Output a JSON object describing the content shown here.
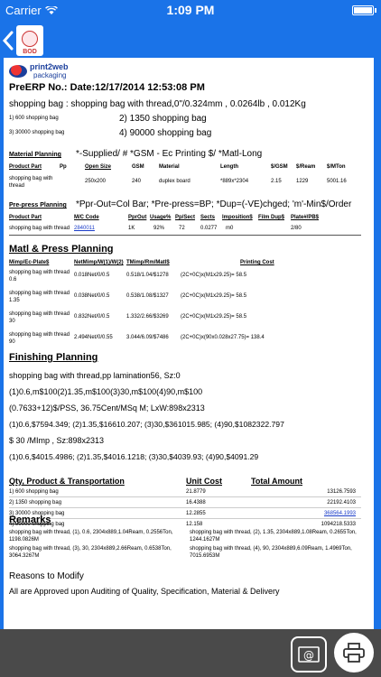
{
  "status": {
    "carrier": "Carrier",
    "time": "1:09 PM"
  },
  "nav": {
    "logo_label": "BOD"
  },
  "brand": {
    "name": "print2web",
    "sub": "packaging"
  },
  "doc": {
    "title": "PreERP No.: Date:12/17/2014 12:53:08 PM",
    "product_line": "shopping bag : shopping bag with thread,0\"/0.324mm , 0.0264lb , 0.012Kg",
    "qty_items": [
      "1) 600 shopping bag",
      "2) 1350 shopping bag",
      "3) 30000 shopping bag",
      "4) 90000 shopping bag"
    ]
  },
  "material_planning": {
    "title": "Material Planning",
    "legend": "*-Supplied/ # *GSM - Ec Printing $/ *Matl-Long",
    "headers": [
      "Product Part",
      "Pp",
      "Open Size",
      "GSM",
      "Material",
      "Length",
      "$/GSM",
      "$/Ream",
      "$/MTon"
    ],
    "row": [
      "shopping bag with thread",
      "",
      "250x200",
      "240",
      "duplex board",
      "*889x*2304",
      "2.15",
      "1229",
      "5001.16"
    ]
  },
  "prepress_planning": {
    "title": "Pre-press Planning",
    "legend": "*Ppr-Out=Col Bar; *Pre-press=BP; *Dup=(-VE)chged; 'm'-Min$/Order",
    "headers": [
      "Product Part",
      "M/C Code",
      "PprOut",
      "Usage%",
      "Pp/Sect",
      "Sects",
      "Imposition$",
      "Film Dup$",
      "Plate#/PB$"
    ],
    "row": [
      "shopping bag with thread",
      "2840011",
      "1K",
      "92%",
      "72",
      "0.0277",
      "m0",
      "",
      "2/80"
    ]
  },
  "matl_press": {
    "title": "Matl & Press Planning",
    "headers": [
      "Mimp/Ec-Plate$",
      "NetMimp/W(1)/W(2)",
      "TMimp/Rm/Matl$",
      "Printing Cost"
    ],
    "rows": [
      [
        "shopping bag with thread 0.6",
        "0.018Net/0/0.5",
        "0.518/1.04/$1278",
        "(2C+0C)x(M1x29.25)= 58.5"
      ],
      [
        "shopping bag with thread 1.35",
        "0.038Net/0/0.5",
        "0.538/1.08/$1327",
        "(2C+0C)x(M1x29.25)= 58.5"
      ],
      [
        "shopping bag with thread 30",
        "0.832Net/0/0.5",
        "1.332/2.66/$3269",
        "(2C+0C)x(M1x29.25)= 58.5"
      ],
      [
        "shopping bag with thread 90",
        "2.494Net/0/0.55",
        "3.044/6.09/$7486",
        "(2C+0C)x(90x0.028x27.75)= 138.4"
      ]
    ]
  },
  "finishing": {
    "title": "Finishing Planning",
    "lines": [
      "shopping bag with thread,pp lamination56, Sz:0",
      "(1)0.6,m$100(2)1.35,m$100(3)30,m$100(4)90,m$100",
      "(0.7633+12)$/PSS, 36.75Cent/MSq M; LxW:898x2313",
      "(1)0.6,$7594.349; (2)1.35,$16610.207; (3)30,$361015.985; (4)90,$1082322.797",
      "$ 30 /MImp , Sz:898x2313",
      "(1)0.6,$4015.4986; (2)1.35,$4016.1218; (3)30,$4039.93; (4)90,$4091.29"
    ]
  },
  "qty_transport": {
    "title": "Qty, Product & Transportation",
    "headers": [
      "Unit Cost",
      "Total Amount"
    ],
    "rows": [
      [
        "1) 600 shopping bag",
        "21.8779",
        "13126.7593"
      ],
      [
        "2) 1350 shopping bag",
        "16.4388",
        "22192.4103"
      ],
      [
        "3) 30000 shopping bag",
        "12.2855",
        "368564.1993"
      ],
      [
        "4) 90000 shopping bag",
        "12.158",
        "1094218.5333"
      ]
    ]
  },
  "remarks": {
    "title": "Remarks",
    "items": [
      [
        "shopping bag with thread, (1), 0.6, 2304x889,1.04Ream, 0.2556Ton,",
        "1198.0826M"
      ],
      [
        "shopping bag with thread, (2), 1.35, 2304x889,1.08Ream, 0.2655Ton,",
        "1244.1627M"
      ],
      [
        "shopping bag with thread, (3), 30, 2304x889,2.66Ream, 0.6538Ton,",
        "3064.3267M"
      ],
      [
        "shopping bag with thread, (4), 90, 2304x889,6.09Ream, 1.4969Ton,",
        "7015.6953M"
      ]
    ]
  },
  "reasons": {
    "title": "Reasons to Modify",
    "text": "All are Approved upon Auditing of Quality, Specification, Material & Delivery"
  },
  "colors": {
    "primary": "#1a73e8",
    "toolbar": "#4a4a4a",
    "link": "#1a3cc9"
  },
  "icons": [
    "wifi-icon",
    "battery-icon",
    "back-chevron-icon",
    "bod-logo-icon",
    "email-icon",
    "print-icon"
  ]
}
